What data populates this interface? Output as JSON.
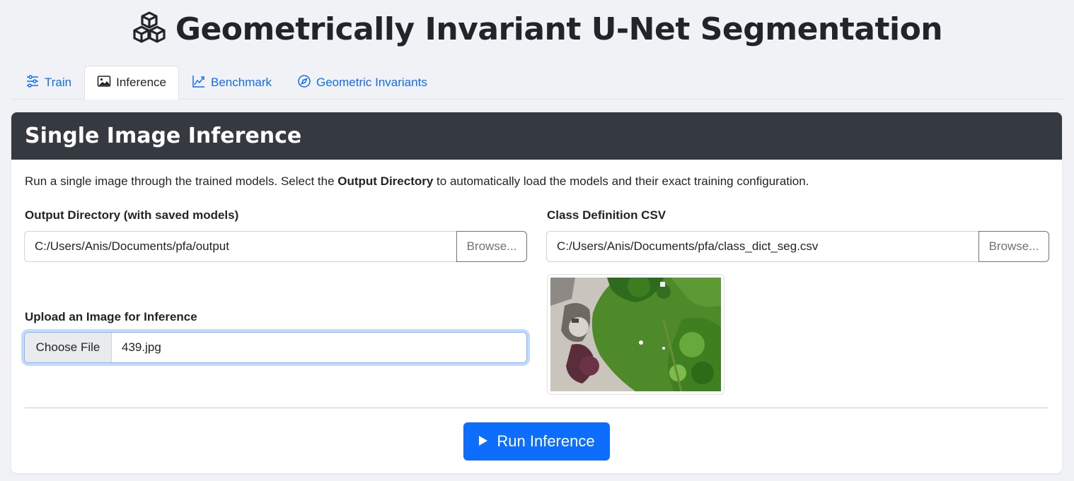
{
  "app": {
    "title": "Geometrically Invariant U-Net Segmentation",
    "title_icon": "boxes-icon"
  },
  "tabs": [
    {
      "label": "Train",
      "icon": "sliders-icon",
      "active": false
    },
    {
      "label": "Inference",
      "icon": "image-icon",
      "active": true
    },
    {
      "label": "Benchmark",
      "icon": "graph-up-icon",
      "active": false
    },
    {
      "label": "Geometric Invariants",
      "icon": "compass-icon",
      "active": false
    }
  ],
  "card": {
    "title": "Single Image Inference",
    "description_prefix": "Run a single image through the trained models. Select the ",
    "description_bold": "Output Directory",
    "description_suffix": " to automatically load the models and their exact training configuration."
  },
  "output_dir": {
    "label": "Output Directory (with saved models)",
    "value": "C:/Users/Anis/Documents/pfa/output",
    "browse_label": "Browse..."
  },
  "class_csv": {
    "label": "Class Definition CSV",
    "value": "C:/Users/Anis/Documents/pfa/class_dict_seg.csv",
    "browse_label": "Browse..."
  },
  "upload": {
    "label": "Upload an Image for Inference",
    "button_label": "Choose File",
    "file_name": "439.jpg"
  },
  "run_button": {
    "label": "Run Inference",
    "icon": "play-icon",
    "color": "#0d6efd"
  },
  "colors": {
    "header_bg": "#343a40",
    "link": "#0d6efd",
    "page_bg": "#f0f2f6"
  }
}
